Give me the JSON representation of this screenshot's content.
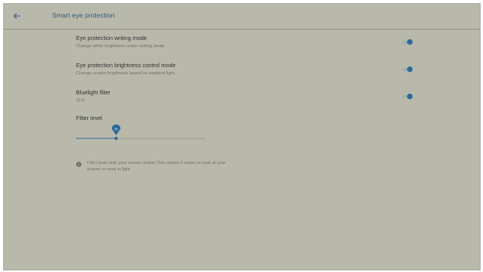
{
  "header": {
    "title": "Smart eye protection"
  },
  "settings": [
    {
      "title": "Eye protection writing mode",
      "subtitle": "Change white brightness under writing mode",
      "enabled": true
    },
    {
      "title": "Eye protection brightness control mode",
      "subtitle": "Change screen brightness based on ambient light",
      "enabled": true
    },
    {
      "title": "Bluelight filter",
      "subtitle": "31%",
      "enabled": true
    }
  ],
  "filter": {
    "label": "Filter level",
    "value": 31,
    "min": 0,
    "max": 100
  },
  "info": {
    "text": "Filter level tints your screen amber.This makes it easier to look at your screen or read in light"
  },
  "colors": {
    "accent": "#2d6a9c",
    "background": "#b9b9ab"
  },
  "icons": {
    "back": "arrow-left-icon",
    "info": "info-circle-icon"
  }
}
